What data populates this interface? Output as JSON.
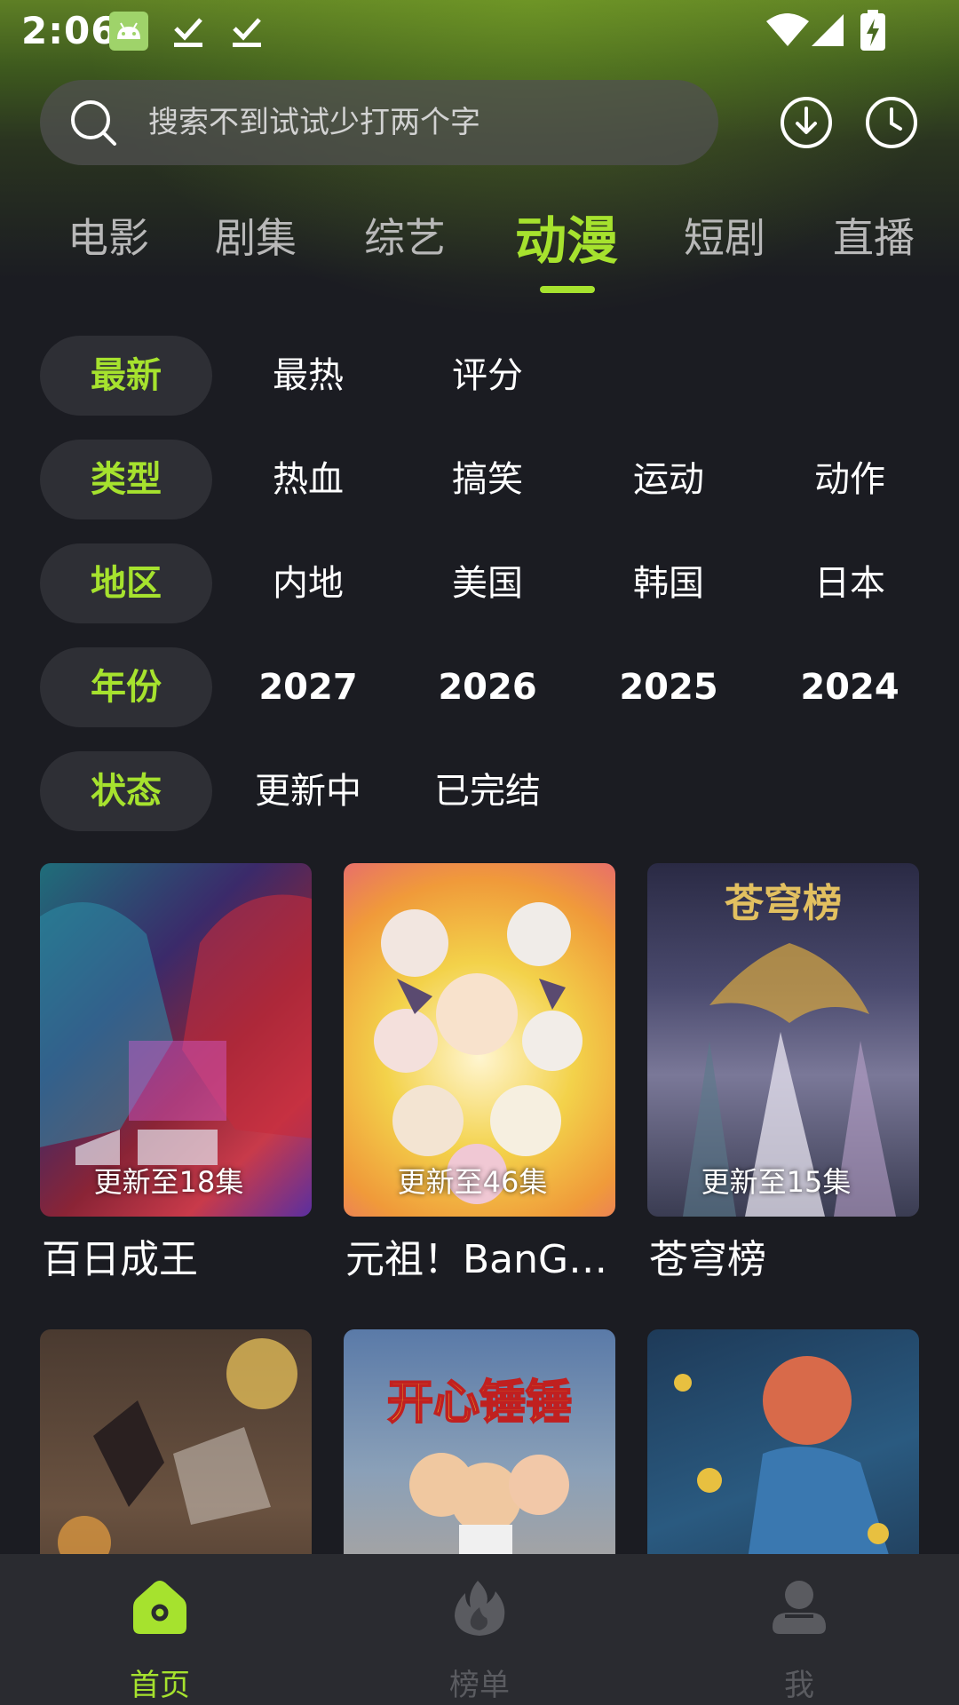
{
  "status_bar": {
    "time": "2:06"
  },
  "search": {
    "placeholder": "搜索不到试试少打两个字"
  },
  "tabs": [
    {
      "label": "电影"
    },
    {
      "label": "剧集"
    },
    {
      "label": "综艺"
    },
    {
      "label": "动漫",
      "active": true
    },
    {
      "label": "短剧"
    },
    {
      "label": "直播"
    }
  ],
  "filters": {
    "sort": {
      "options": [
        "最新",
        "最热",
        "评分"
      ]
    },
    "genre": {
      "label": "类型",
      "options": [
        "热血",
        "搞笑",
        "运动",
        "动作"
      ]
    },
    "region": {
      "label": "地区",
      "options": [
        "内地",
        "美国",
        "韩国",
        "日本"
      ]
    },
    "year": {
      "label": "年份",
      "options": [
        "2027",
        "2026",
        "2025",
        "2024"
      ]
    },
    "status": {
      "label": "状态",
      "options": [
        "更新中",
        "已完结"
      ]
    }
  },
  "cards": [
    {
      "title": "百日成王",
      "badge": "更新至18集"
    },
    {
      "title": "元祖！BanGDream",
      "badge": "更新至46集"
    },
    {
      "title": "苍穹榜",
      "badge": "更新至15集"
    },
    {
      "title": "",
      "badge": ""
    },
    {
      "title": "",
      "badge": ""
    },
    {
      "title": "",
      "badge": ""
    }
  ],
  "bottom_nav": [
    {
      "label": "首页",
      "active": true
    },
    {
      "label": "榜单"
    },
    {
      "label": "我"
    }
  ],
  "colors": {
    "accent": "#a6e22e",
    "background": "#1b1c22",
    "inactive": "#5a5b60"
  }
}
